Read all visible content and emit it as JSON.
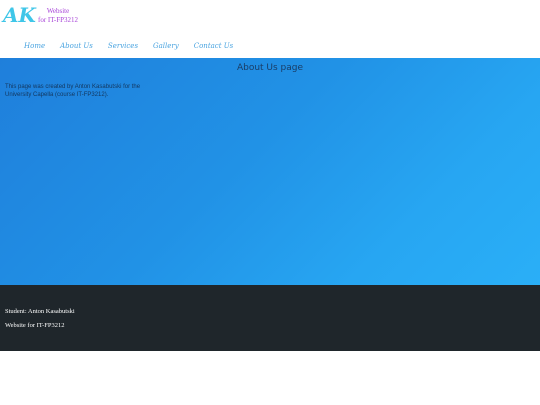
{
  "header": {
    "logo_text": "AK",
    "site_title_line1": "Website",
    "site_title_line2": "for IT-FP3212"
  },
  "nav": {
    "items": [
      {
        "label": "Home"
      },
      {
        "label": "About Us"
      },
      {
        "label": "Services"
      },
      {
        "label": "Gallery"
      },
      {
        "label": "Contact Us"
      }
    ]
  },
  "main": {
    "heading": "About Us page",
    "intro_text": "This page was created by Anton Kasabutski for the University Capella (course IT-FP3212)."
  },
  "footer": {
    "student": "Student: Anton Kasabutski",
    "website": "Website for IT-FP3212"
  },
  "colors": {
    "logo": "#3fc6e8",
    "site_title": "#a845d8",
    "nav_link": "#4aa4e0",
    "main_gradient_start": "#1f7fdb",
    "main_gradient_end": "#2aaff7",
    "footer_bg": "#1f262b"
  }
}
